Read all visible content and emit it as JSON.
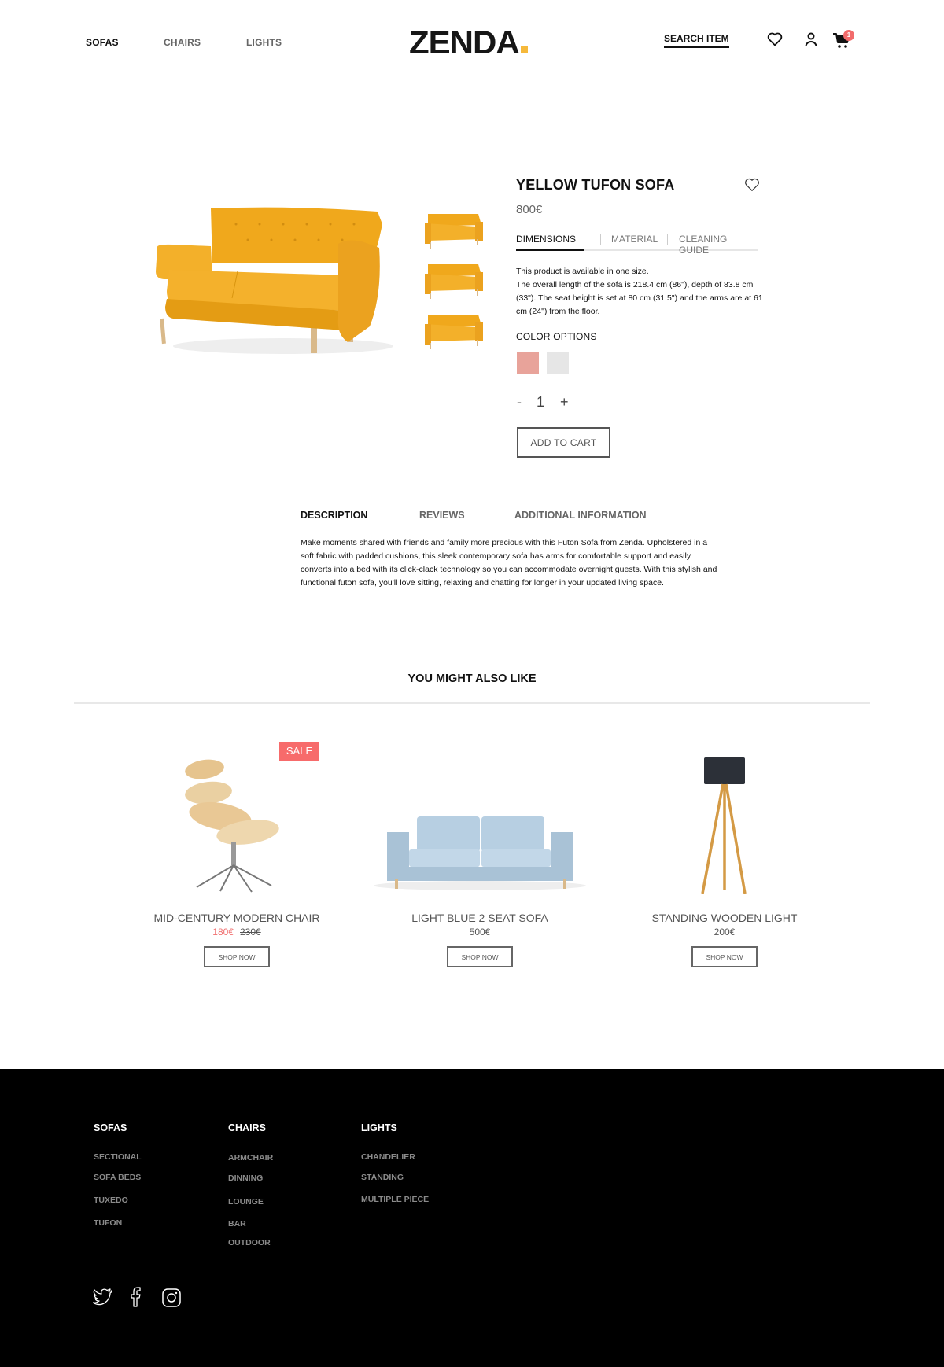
{
  "header": {
    "nav": [
      {
        "label": "SOFAS",
        "active": true
      },
      {
        "label": "CHAIRS",
        "active": false
      },
      {
        "label": "LIGHTS",
        "active": false
      }
    ],
    "logo": "ZENDA",
    "logo_accent_color": "#f6b93b",
    "search_label": "SEARCH ITEM",
    "icons": [
      "heart-icon",
      "user-icon",
      "cart-icon"
    ],
    "cart_count": "1"
  },
  "product": {
    "title": "YELLOW TUFON SOFA",
    "price": "800€",
    "thumbnails_count": 3,
    "tabs": [
      {
        "label": "DIMENSIONS",
        "active": true
      },
      {
        "label": "MATERIAL",
        "active": false
      },
      {
        "label": "CLEANING GUIDE",
        "active": false
      }
    ],
    "dimensions_line1": "This product is available in one size.",
    "dimensions_line2": "The overall length of the sofa is 218.4 cm (86\"), depth of 83.8 cm (33\"). The seat height is set at 80 cm (31.5\") and the arms are at 61 cm (24\") from the floor.",
    "color_options_label": "COLOR OPTIONS",
    "color_options": [
      "#e8a39a",
      "#e6e6e6"
    ],
    "quantity": {
      "minus": "-",
      "value": "1",
      "plus": "+"
    },
    "add_to_cart_label": "ADD TO CART"
  },
  "details": {
    "tabs": [
      {
        "label": "DESCRIPTION",
        "active": true
      },
      {
        "label": "REVIEWS",
        "active": false
      },
      {
        "label": "ADDITIONAL INFORMATION",
        "active": false
      }
    ],
    "description": "Make moments shared with friends and family more precious with this Futon Sofa from Zenda. Upholstered in a soft fabric with padded cushions, this sleek contemporary sofa has arms for comfortable support and easily converts into a bed with its click-clack technology so you can accommodate overnight guests. With this stylish and functional futon sofa, you'll love sitting, relaxing and chatting for longer in your updated living space."
  },
  "recommendations": {
    "title": "YOU MIGHT ALSO LIKE",
    "items": [
      {
        "name": "MID-CENTURY MODERN CHAIR",
        "price": "180€",
        "old_price": "230€",
        "badge": "SALE",
        "button": "SHOP NOW"
      },
      {
        "name": "LIGHT BLUE 2 SEAT SOFA",
        "price": "500€",
        "button": "SHOP NOW"
      },
      {
        "name": "STANDING WOODEN LIGHT",
        "price": "200€",
        "button": "SHOP NOW"
      }
    ]
  },
  "footer": {
    "columns": [
      {
        "title": "SOFAS",
        "links": [
          "SECTIONAL",
          "SOFA BEDS",
          "TUXEDO",
          "TUFON"
        ]
      },
      {
        "title": "CHAIRS",
        "links": [
          "ARMCHAIR",
          "DINNING",
          "LOUNGE",
          "BAR",
          "OUTDOOR"
        ]
      },
      {
        "title": "LIGHTS",
        "links": [
          "CHANDELIER",
          "STANDING",
          "MULTIPLE PIECE"
        ]
      }
    ],
    "social": [
      "twitter-icon",
      "facebook-icon",
      "instagram-icon"
    ]
  }
}
